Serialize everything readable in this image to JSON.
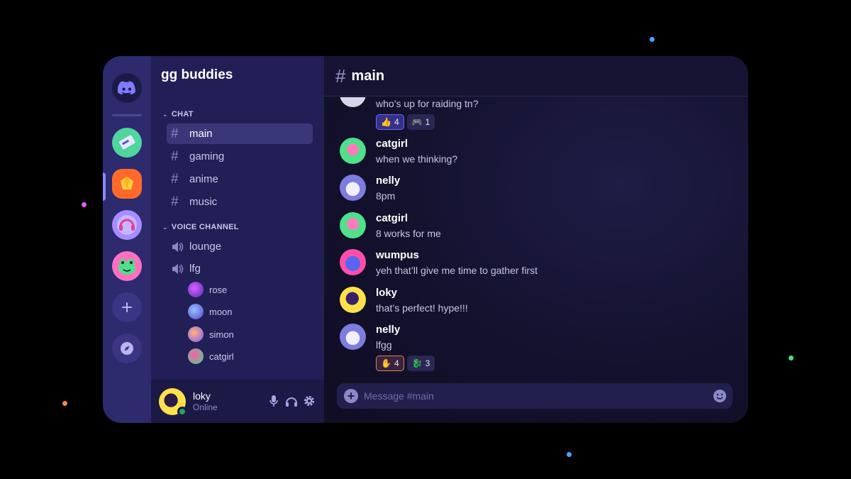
{
  "colors": {
    "accent": "#6c68ff",
    "rail": "#2d2a6e",
    "sidebar": "#221f56",
    "online": "#23a55a"
  },
  "server": {
    "name": "gg buddies"
  },
  "servers": [
    {
      "icon": "discord-logo-icon"
    },
    {
      "icon": "ticket-server-icon"
    },
    {
      "icon": "gem-server-icon"
    },
    {
      "icon": "headphones-server-icon"
    },
    {
      "icon": "frog-server-icon"
    },
    {
      "icon": "add-server-icon"
    },
    {
      "icon": "compass-icon"
    }
  ],
  "sidebar": {
    "chat_category": "CHAT",
    "voice_category": "VOICE CHANNEL",
    "text_channels": [
      "main",
      "gaming",
      "anime",
      "music"
    ],
    "voice_channels": [
      "lounge",
      "lfg"
    ],
    "voice_users": [
      "rose",
      "moon",
      "simon",
      "catgirl"
    ]
  },
  "user": {
    "name": "loky",
    "status": "Online"
  },
  "channel": {
    "name": "main",
    "placeholder": "Message #main"
  },
  "messages": [
    {
      "author": "",
      "text": "who’s up for raiding tn?",
      "reactions": [
        {
          "emoji": "👍",
          "count": "4"
        },
        {
          "emoji": "🎮",
          "count": "1"
        }
      ]
    },
    {
      "author": "catgirl",
      "text": "when we thinking?"
    },
    {
      "author": "nelly",
      "text": "8pm"
    },
    {
      "author": "catgirl",
      "text": "8 works for me"
    },
    {
      "author": "wumpus",
      "text": "yeh that’ll give me time to gather first"
    },
    {
      "author": "loky",
      "text": "that’s perfect! hype!!!"
    },
    {
      "author": "nelly",
      "text": "lfgg",
      "reactions": [
        {
          "emoji": "✋",
          "count": "4"
        },
        {
          "emoji": "🐉",
          "count": "3"
        }
      ]
    }
  ]
}
